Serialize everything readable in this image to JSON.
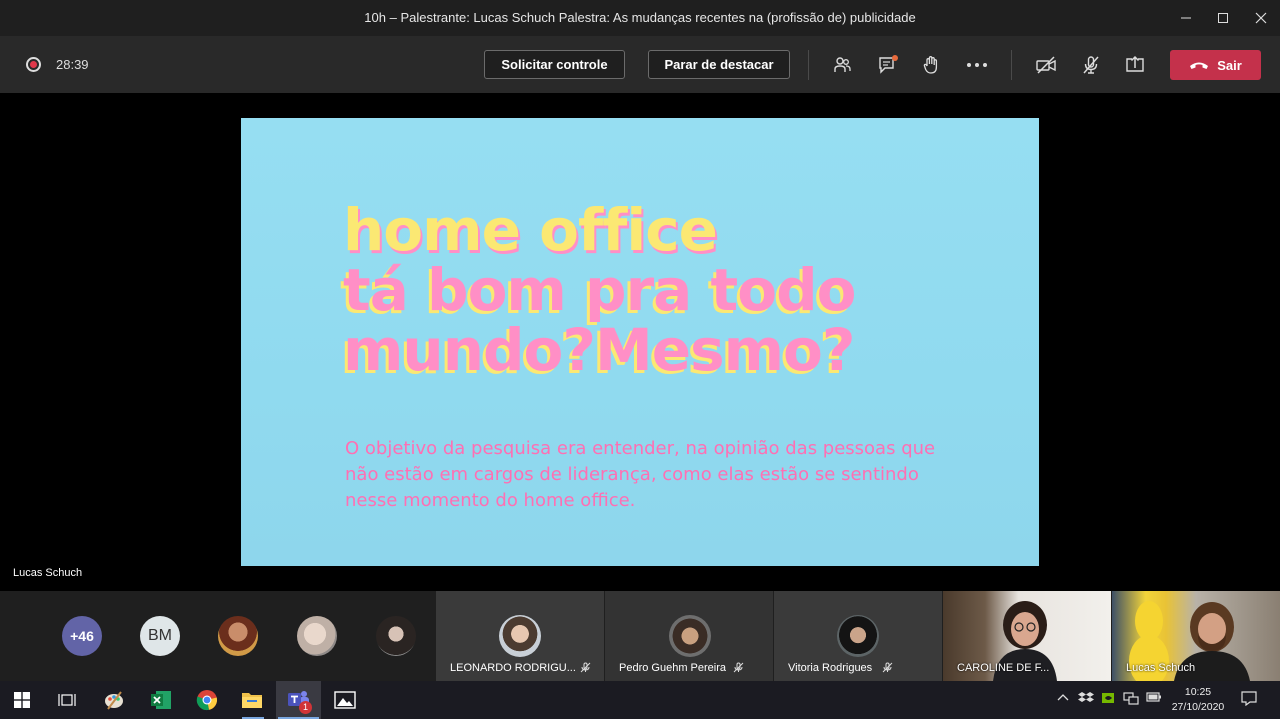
{
  "window": {
    "title": "10h – Palestrante: Lucas Schuch Palestra: As mudanças recentes na (profissão de) publicidade"
  },
  "toolbar": {
    "timer": "28:39",
    "request_control_label": "Solicitar controle",
    "stop_spotlight_label": "Parar de destacar",
    "leave_label": "Sair",
    "leave_color": "#c4314b"
  },
  "slide": {
    "headline_line1": "home office",
    "headline_line2": "tá bom pra todo",
    "headline_line3": "mundo?Mesmo?",
    "paragraph": "O objetivo da pesquisa era entender, na opinião das pessoas que não estão em cargos de liderança, como elas estão se sentindo nesse momento do home office.",
    "background_color": "#96def2",
    "pink": "#ff8fc6",
    "yellow": "#fbe873"
  },
  "stage": {
    "presenter_name": "Lucas Schuch"
  },
  "participants": {
    "overflow_count": "+46",
    "initials_avatar": "BM",
    "tiles": [
      {
        "name": "LEONARDO RODRIGU..."
      },
      {
        "name": "Pedro Guehm Pereira"
      },
      {
        "name": "Vitoria Rodrigues"
      }
    ],
    "videos": [
      {
        "name": "CAROLINE DE F..."
      },
      {
        "name": "Lucas Schuch"
      }
    ]
  },
  "taskbar": {
    "time": "10:25",
    "date": "27/10/2020",
    "teams_badge": "1"
  }
}
